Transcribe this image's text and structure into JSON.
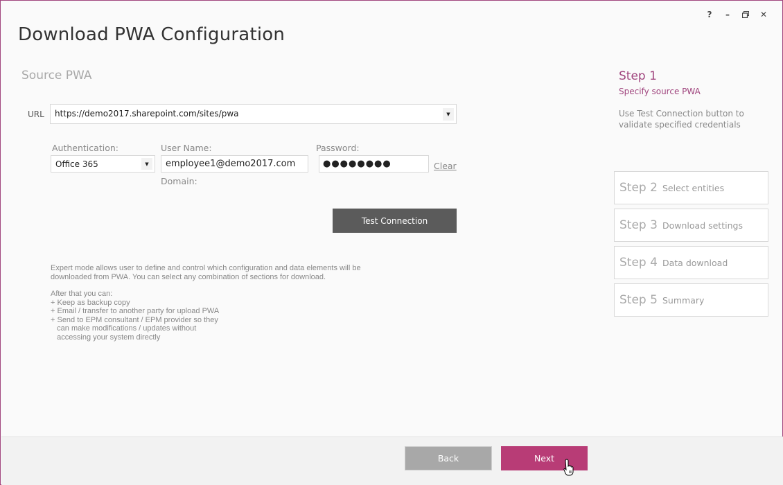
{
  "window": {
    "title": "Download PWA Configuration",
    "controls": {
      "help": "?",
      "minimize": "–",
      "restore": "🗗",
      "close": "✕"
    }
  },
  "source": {
    "section_title": "Source PWA",
    "url_label": "URL",
    "url_value": "https://demo2017.sharepoint.com/sites/pwa",
    "auth_label": "Authentication:",
    "auth_value": "Office 365",
    "username_label": "User Name:",
    "username_value": "employee1@demo2017.com",
    "password_label": "Password:",
    "password_value": "●●●●●●●●",
    "clear_label": "Clear",
    "domain_label": "Domain:",
    "test_button": "Test Connection"
  },
  "info": {
    "paragraph1": "Expert mode allows user to define and control which configuration and data elements will be\ndownloaded from PWA. You can select any combination of sections for download.",
    "paragraph2": "After that you can:\n+ Keep as backup copy\n+ Email / transfer to another party for upload PWA\n+ Send to EPM consultant / EPM provider so they\n   can make modifications / updates without\n   accessing your system directly"
  },
  "steps": {
    "active": {
      "title": "Step 1",
      "subtitle": "Specify source PWA",
      "hint": "Use Test Connection button to validate specified credentials"
    },
    "items": [
      {
        "num": "Step 2",
        "name": "Select entities"
      },
      {
        "num": "Step 3",
        "name": "Download settings"
      },
      {
        "num": "Step 4",
        "name": "Data download"
      },
      {
        "num": "Step 5",
        "name": "Summary"
      }
    ]
  },
  "footer": {
    "back_label": "Back",
    "next_label": "Next"
  },
  "colors": {
    "accent": "#a0457e",
    "next_button": "#b83c76",
    "test_button": "#5b5b5b",
    "back_button": "#a8a8a8"
  }
}
